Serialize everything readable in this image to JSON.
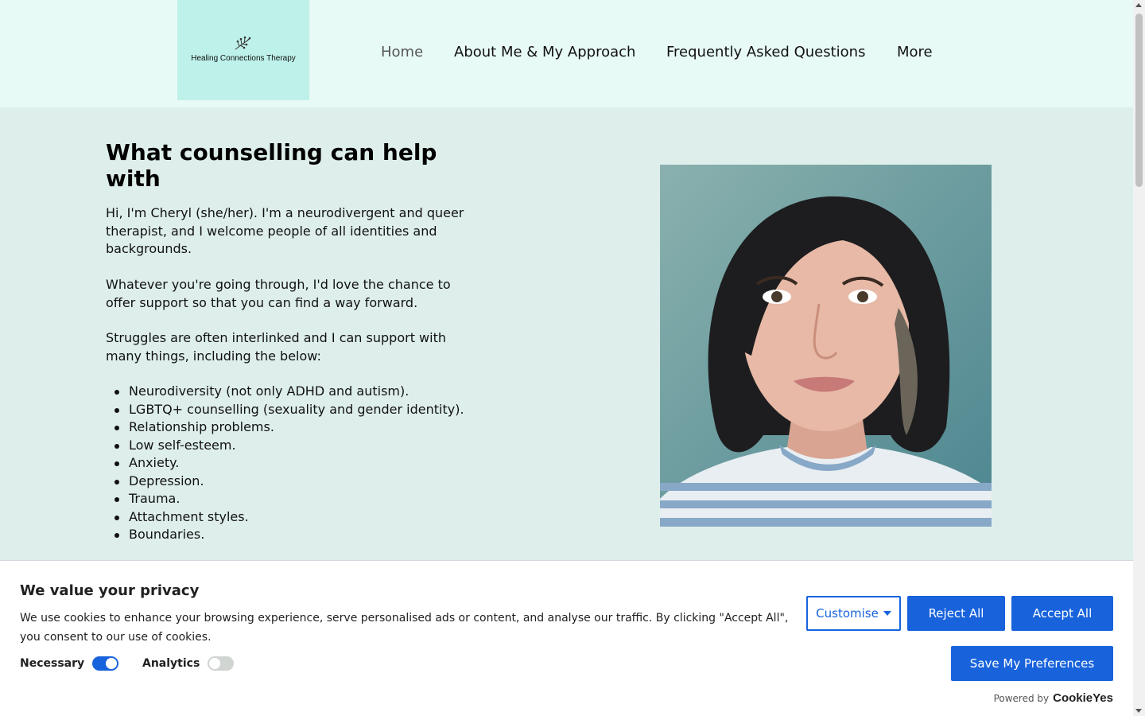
{
  "header": {
    "logo_text": "Healing Connections Therapy",
    "nav": [
      {
        "label": "Home",
        "active": true
      },
      {
        "label": "About Me & My Approach"
      },
      {
        "label": "Frequently Asked Questions"
      },
      {
        "label": "More"
      }
    ]
  },
  "main": {
    "heading": "What counselling can help with",
    "paragraphs": [
      "Hi, I'm Cheryl (she/her). I'm a neurodivergent and queer therapist, and I welcome people of all identities and backgrounds.",
      "Whatever you're going through, I'd love the chance to offer support so that you can find a way forward.",
      "Struggles are often interlinked and I can support with many things, including the below:"
    ],
    "list": [
      "Neurodiversity (not only ADHD and autism).",
      "LGBTQ+ counselling (sexuality and gender identity).",
      "Relationship problems.",
      "Low self-esteem.",
      "Anxiety.",
      "Depression.",
      "Trauma.",
      "Attachment styles.",
      "Boundaries."
    ]
  },
  "cookie": {
    "title": "We value your privacy",
    "description": "We use cookies to enhance your browsing experience, serve personalised ads or content, and analyse our traffic. By clicking \"Accept All\", you consent to our use of cookies.",
    "toggles": [
      {
        "label": "Necessary",
        "on": true
      },
      {
        "label": "Analytics",
        "on": false
      }
    ],
    "buttons": {
      "customise": "Customise",
      "reject": "Reject All",
      "accept": "Accept All",
      "save": "Save My Preferences"
    },
    "powered_by": "Powered by",
    "brand": "CookieYes"
  },
  "colors": {
    "header_bg": "#e8faf6",
    "logo_bg": "#bdf1e9",
    "page_bg": "#deefeb",
    "accent": "#1863dc"
  }
}
